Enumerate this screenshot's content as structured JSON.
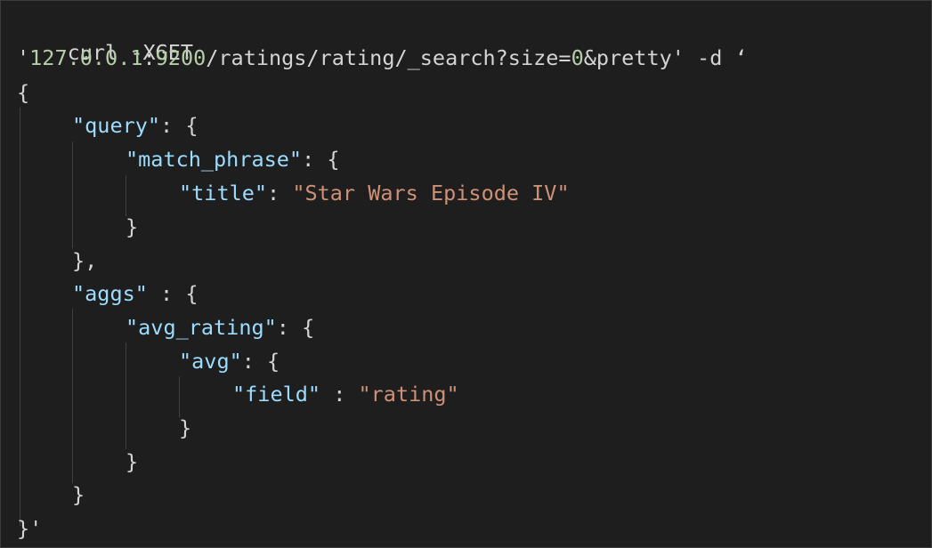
{
  "colors": {
    "background": "#1e1e1e",
    "punctuation": "#d4d4d4",
    "key": "#9cdcfe",
    "string": "#ce9178",
    "number": "#b5cea8",
    "indent_guide": "#404040"
  },
  "code": {
    "line1": {
      "command": "curl -XGET"
    },
    "line2": {
      "quote_open": "'",
      "ip": "127.0.0.1",
      "colon": ":",
      "port": "9200",
      "path_a": "/ratings/rating/_search?size=",
      "size_value": "0",
      "path_b": "&pretty' -d ‘"
    },
    "line3": {
      "brace": "{"
    },
    "line4": {
      "key": "\"query\"",
      "rest": ": {"
    },
    "line5": {
      "key": "\"match_phrase\"",
      "rest": ": {"
    },
    "line6": {
      "key": "\"title\"",
      "colon": ": ",
      "value": "\"Star Wars Episode IV\""
    },
    "line7": {
      "brace": "}"
    },
    "line8": {
      "brace": "},"
    },
    "line9": {
      "key": "\"aggs\"",
      "rest": " : {"
    },
    "line10": {
      "key": "\"avg_rating\"",
      "rest": ": {"
    },
    "line11": {
      "key": "\"avg\"",
      "rest": ": {"
    },
    "line12": {
      "key": "\"field\"",
      "colon": " : ",
      "value": "\"rating\""
    },
    "line13": {
      "brace": "}"
    },
    "line14": {
      "brace": "}"
    },
    "line15": {
      "brace": "}"
    },
    "line16": {
      "brace": "}'"
    }
  }
}
